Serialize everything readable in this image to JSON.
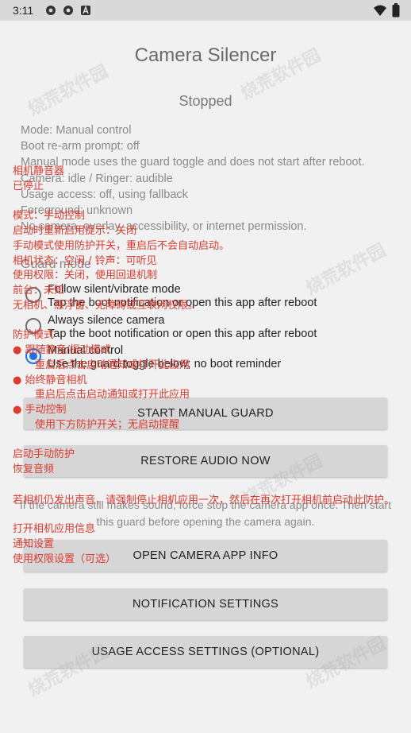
{
  "status_bar": {
    "time": "3:11",
    "left_icons": [
      "settings-icon",
      "settings-icon",
      "notification-a-icon"
    ],
    "right_icons": [
      "wifi-icon",
      "battery-icon"
    ]
  },
  "app": {
    "title": "Camera Silencer",
    "status": "Stopped",
    "info_lines": [
      "Mode: Manual control",
      "Boot re-arm prompt: off",
      "Manual mode uses the guard toggle and does not start after reboot.",
      "Camera: idle / Ringer: audible",
      "Usage access: off, using fallback",
      "Foreground: unknown",
      "No camera, overlay, accessibility, or internet permission."
    ],
    "guard_mode_title": "Guard mode",
    "guard_modes": [
      {
        "title": "Follow silent/vibrate mode",
        "subtitle": "Tap the boot notification or open this app after reboot",
        "selected": false
      },
      {
        "title": "Always silence camera",
        "subtitle": "Tap the boot notification or open this app after reboot",
        "selected": false
      },
      {
        "title": "Manual control",
        "subtitle": "Use the guard toggle below; no boot reminder",
        "selected": true
      }
    ],
    "buttons": {
      "start": "START MANUAL GUARD",
      "restore": "RESTORE AUDIO NOW",
      "open_camera_info": "OPEN CAMERA APP INFO",
      "notification_settings": "NOTIFICATION SETTINGS",
      "usage_access_settings": "USAGE ACCESS SETTINGS (OPTIONAL)"
    },
    "note": "If the camera still makes sound, force stop the camera app once. Then start this guard before opening the camera again."
  },
  "translation_overlay": {
    "title": "相机静音器",
    "status": "已停止",
    "mode": "模式：手动控制",
    "boot": "启动时重新启用提示：关闭",
    "manual": "手动模式使用防护开关，重启后不会自动启动。",
    "camera": "相机状态：空闲 / 铃声：可听见",
    "usage": "使用权限：关闭，使用回退机制",
    "foreground": "前台：未知",
    "permissions": "无相机、悬浮窗、无障碍或互联网权限。",
    "guard_mode": "防护模式",
    "mode_follow": "● 跟随静音/振动模式",
    "mode_follow_sub": "重启后点击启动通知或打开此应用",
    "mode_always": "● 始终静音相机",
    "mode_always_sub": "重启后点击启动通知或打开此应用",
    "mode_manual": "● 手动控制",
    "mode_manual_sub": "使用下方防护开关；无启动提醒",
    "start": "启动手动防护",
    "restore": "恢复音频",
    "note": "若相机仍发出声音，请强制停止相机应用一次，然后在再次打开相机前启动此防护。",
    "open_camera_info": "打开相机应用信息",
    "notification_settings": "通知设置",
    "usage_access": "使用权限设置（可选）"
  },
  "watermark_text": "烧荒软件园",
  "colors": {
    "accent": "#1a73e8",
    "overlay_red": "#e03a2e",
    "status_bar": "#d9d9d9",
    "app_bg": "#f1f1f1",
    "button_bg": "#d6d6d6"
  }
}
